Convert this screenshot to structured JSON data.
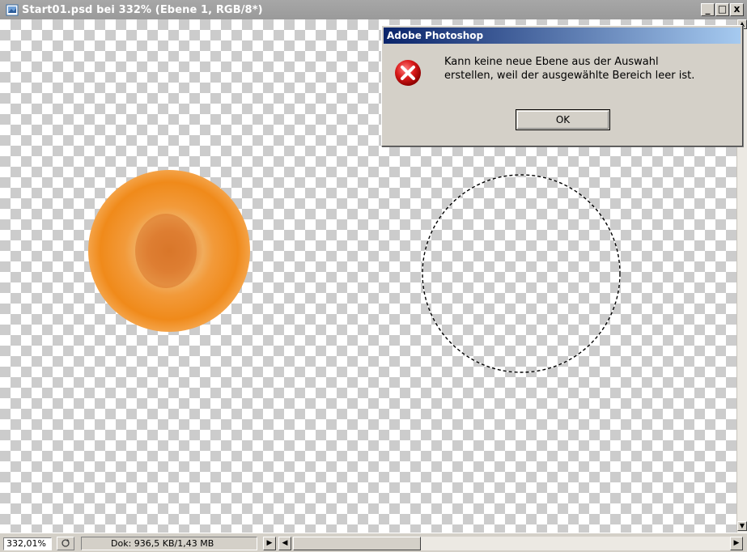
{
  "window": {
    "title": "Start01.psd bei 332% (Ebene 1, RGB/8*)",
    "icon": "photoshop-document-icon",
    "controls": {
      "minimize": "_",
      "maximize": "□",
      "close": "x"
    }
  },
  "canvas": {
    "background": "transparency-checkerboard",
    "orange_slice_color": "#f08a1a",
    "selection": "marching-ants-circle"
  },
  "dialog": {
    "title": "Adobe Photoshop",
    "icon": "error-icon",
    "message": "Kann keine neue Ebene aus der Auswahl\nerstellen, weil der ausgewählte Bereich leer ist.",
    "ok_label": "OK"
  },
  "statusbar": {
    "zoom": "332,01%",
    "doc_info": "Dok: 936,5 KB/1,43 MB"
  },
  "colors": {
    "dialog_title_start": "#0a246a",
    "dialog_title_end": "#a6caf0",
    "inactive_title": "#9a9a9a",
    "error_red": "#d91a1a"
  }
}
